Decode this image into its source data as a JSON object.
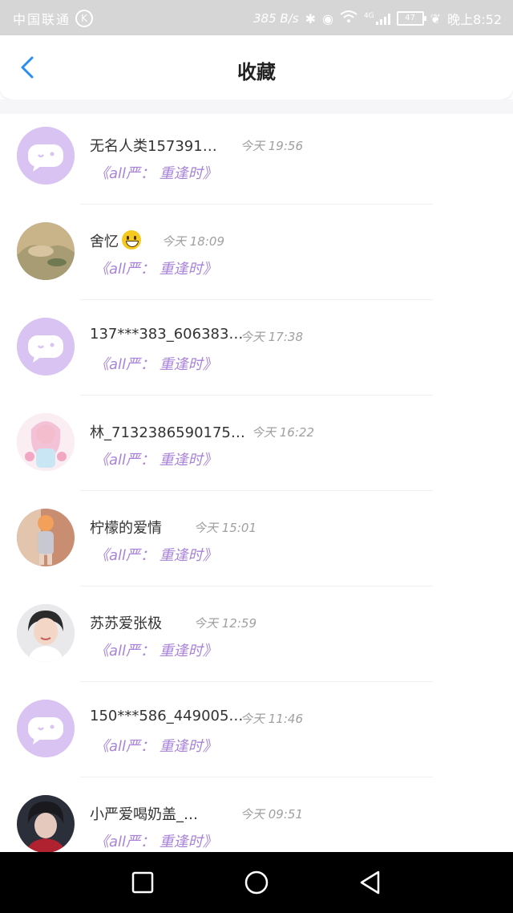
{
  "status_bar": {
    "carrier": "中国联通",
    "carrier_badge": "K",
    "speed": "385 B/s",
    "network": "4G",
    "battery": "47",
    "time": "晚上8:52"
  },
  "header": {
    "title": "收藏",
    "back_icon": "chevron-left-icon"
  },
  "accent_color": "#a883d8",
  "items": [
    {
      "name": "无名人类157391…",
      "time": "今天 19:56",
      "fav": "《all严： 重逢时》",
      "avatar": "chat-bubble"
    },
    {
      "name": "舍忆",
      "time": "今天 18:09",
      "fav": "《all严： 重逢时》",
      "avatar": "photo-landscape",
      "emoji": "grinning-face"
    },
    {
      "name": "137***383_606383…",
      "time": "今天 17:38",
      "fav": "《all严： 重逢时》",
      "avatar": "chat-bubble"
    },
    {
      "name": "林_7132386590175…",
      "time": "今天 16:22",
      "fav": "《all严： 重逢时》",
      "avatar": "photo-anime"
    },
    {
      "name": "柠檬的爱情",
      "time": "今天 15:01",
      "fav": "《all严： 重逢时》",
      "avatar": "photo-child"
    },
    {
      "name": "苏苏爱张极",
      "time": "今天 12:59",
      "fav": "《all严： 重逢时》",
      "avatar": "photo-person"
    },
    {
      "name": "150***586_449005…",
      "time": "今天 11:46",
      "fav": "《all严： 重逢时》",
      "avatar": "chat-bubble"
    },
    {
      "name": "小严爱喝奶盖_…",
      "time": "今天 09:51",
      "fav": "《all严： 重逢时》",
      "avatar": "photo-person-dark"
    }
  ],
  "nav": {
    "recent_icon": "square-icon",
    "home_icon": "circle-icon",
    "back_icon": "triangle-back-icon"
  }
}
